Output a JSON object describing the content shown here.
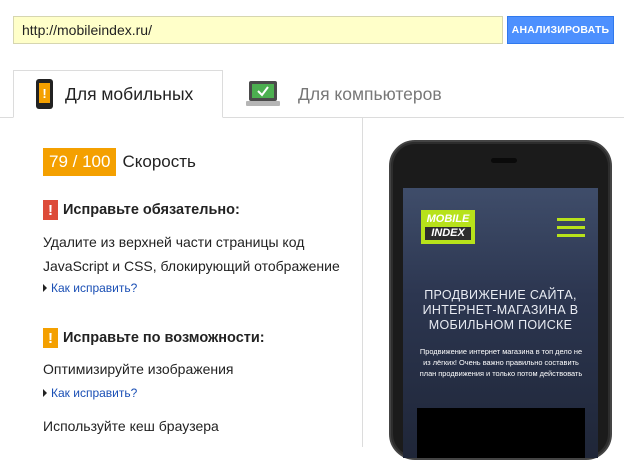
{
  "url_bar": {
    "value": "http://mobileindex.ru/",
    "analyze_label": "АНАЛИЗИРОВАТЬ"
  },
  "tabs": [
    {
      "label": "Для мобильных",
      "icon": "mobile-phone-icon",
      "active": true
    },
    {
      "label": "Для компьютеров",
      "icon": "laptop-icon",
      "active": false
    }
  ],
  "score": {
    "value": "79 / 100",
    "label": "Скорость"
  },
  "sections": [
    {
      "icon_glyph": "!",
      "title": "Исправьте обязательно:",
      "color": "#dd4b39",
      "issues": [
        {
          "text": "Удалите из верхней части страницы код JavaScript и CSS, блокирующий отображение",
          "link": "Как исправить?"
        }
      ]
    },
    {
      "icon_glyph": "!",
      "title": "Исправьте по возможности:",
      "color": "#f4a000",
      "issues": [
        {
          "text": "Оптимизируйте изображения",
          "link": "Как исправить?"
        },
        {
          "text": "Используйте кеш браузера",
          "link": ""
        }
      ]
    }
  ],
  "preview": {
    "logo_line1": "MOBILE",
    "logo_line2": "INDEX",
    "hero_title": "ПРОДВИЖЕНИЕ САЙТА, ИНТЕРНЕТ-МАГАЗИНА В МОБИЛЬНОМ ПОИСКЕ",
    "hero_sub": "Продвижение интернет магазина в топ дело не из лёгких! Очень важно правильно составить план продвижения и только потом действовать"
  },
  "colors": {
    "score_badge": "#f4a000",
    "critical": "#dd4b39",
    "warning": "#f4a000",
    "link": "#1a4fb5",
    "button": "#4d90fe",
    "url_bg": "#ffffc9"
  }
}
